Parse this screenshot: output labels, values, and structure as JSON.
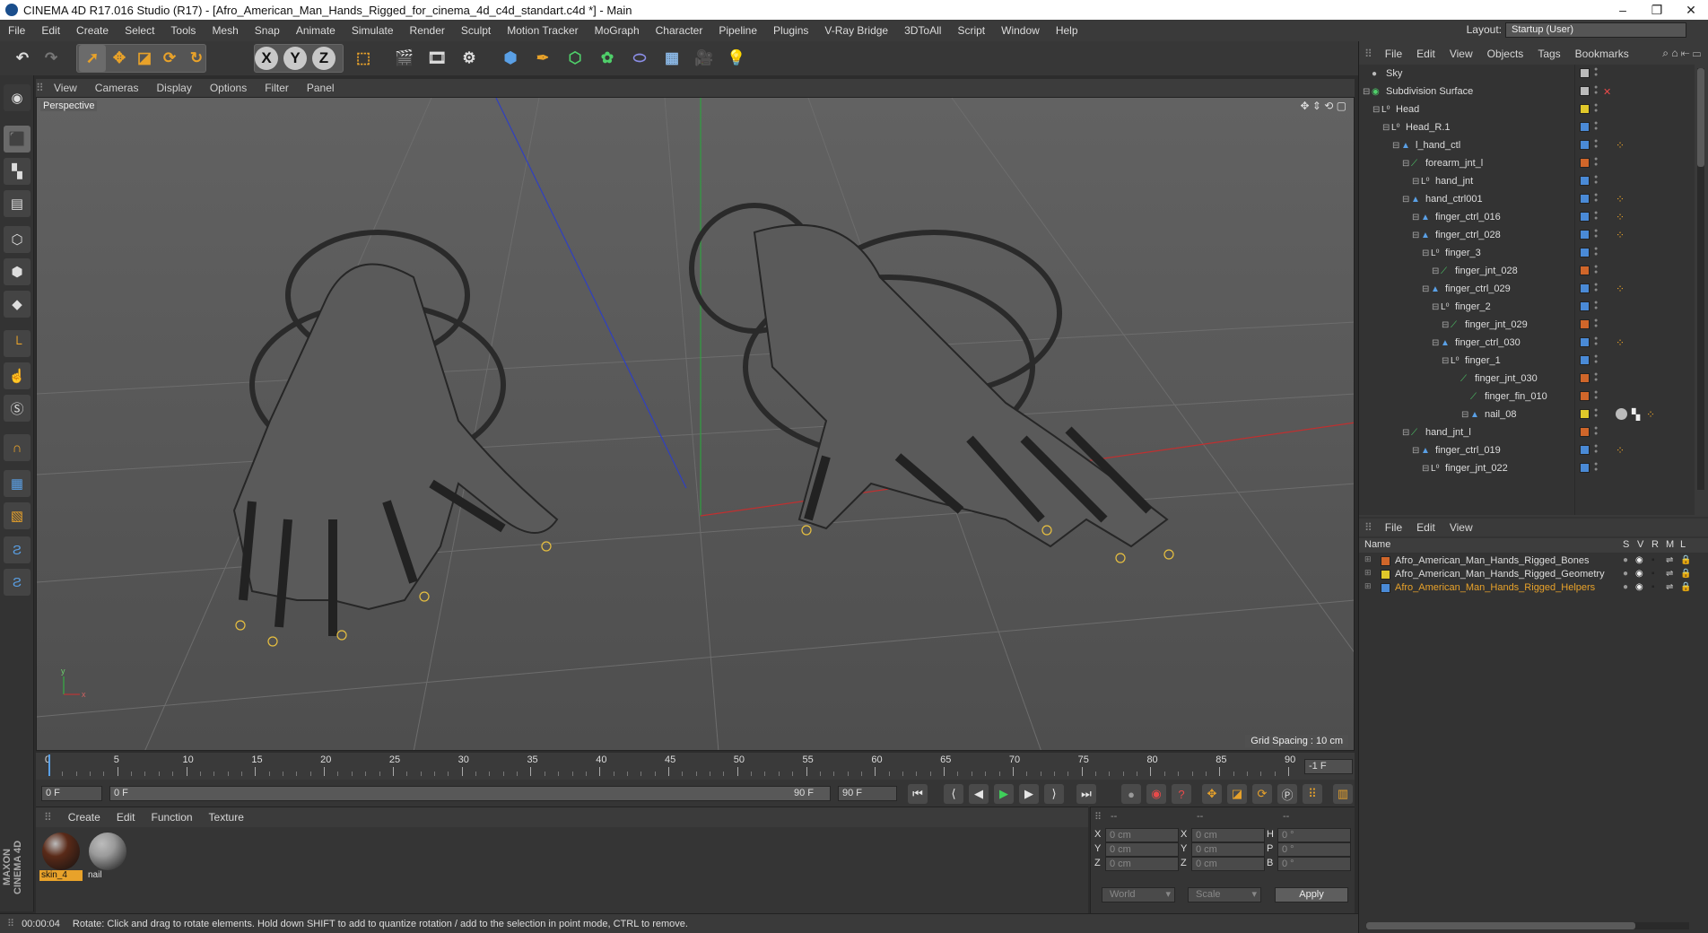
{
  "window": {
    "title": "CINEMA 4D R17.016 Studio (R17) - [Afro_American_Man_Hands_Rigged_for_cinema_4d_c4d_standart.c4d *] - Main",
    "controls": [
      "–",
      "❐",
      "✕"
    ]
  },
  "menubar": {
    "items": [
      "File",
      "Edit",
      "Create",
      "Select",
      "Tools",
      "Mesh",
      "Snap",
      "Animate",
      "Simulate",
      "Render",
      "Sculpt",
      "Motion Tracker",
      "MoGraph",
      "Character",
      "Pipeline",
      "Plugins",
      "V-Ray Bridge",
      "3DToAll",
      "Script",
      "Window",
      "Help"
    ],
    "layout_label": "Layout:",
    "layout_value": "Startup (User)"
  },
  "toolbar": {
    "axis_x": "X",
    "axis_y": "Y",
    "axis_z": "Z"
  },
  "viewport": {
    "menu": [
      "View",
      "Cameras",
      "Display",
      "Options",
      "Filter",
      "Panel"
    ],
    "camera_label": "Perspective",
    "grid_spacing": "Grid Spacing : 10 cm",
    "axis_x": "x",
    "axis_y": "y"
  },
  "timeline": {
    "ticks": [
      "0",
      "5",
      "10",
      "15",
      "20",
      "25",
      "30",
      "35",
      "40",
      "45",
      "50",
      "55",
      "60",
      "65",
      "70",
      "75",
      "80",
      "85",
      "90"
    ],
    "current_frame_field": "-1 F"
  },
  "playback": {
    "start_field": "0 F",
    "range_start": "0 F",
    "range_end": "90 F",
    "end_field": "90 F"
  },
  "materials": {
    "menu": [
      "Create",
      "Edit",
      "Function",
      "Texture"
    ],
    "items": [
      {
        "name": "skin_4",
        "color": "#5a2a18"
      },
      {
        "name": "nail",
        "color": "#9a9a9a"
      }
    ]
  },
  "coordinates": {
    "header": [
      "--",
      "--",
      "--"
    ],
    "rows": [
      {
        "l1": "X",
        "v1": "0 cm",
        "l2": "X",
        "v2": "0 cm",
        "l3": "H",
        "v3": "0 °"
      },
      {
        "l1": "Y",
        "v1": "0 cm",
        "l2": "Y",
        "v2": "0 cm",
        "l3": "P",
        "v3": "0 °"
      },
      {
        "l1": "Z",
        "v1": "0 cm",
        "l2": "Z",
        "v2": "0 cm",
        "l3": "B",
        "v3": "0 °"
      }
    ],
    "coord_system": "World",
    "mode": "Scale",
    "apply": "Apply"
  },
  "status": {
    "time": "00:00:04",
    "message": "Rotate: Click and drag to rotate elements. Hold down SHIFT to add to quantize rotation / add to the selection in point mode, CTRL to remove."
  },
  "object_manager": {
    "menu": [
      "File",
      "Edit",
      "View",
      "Objects",
      "Tags",
      "Bookmarks"
    ],
    "rows": [
      {
        "name": "Sky",
        "depth": 0,
        "type": "sky",
        "color": "#bbbbbb"
      },
      {
        "name": "Subdivision Surface",
        "depth": 0,
        "type": "subd",
        "color": "#bbbbbb"
      },
      {
        "name": "Head",
        "depth": 1,
        "type": "null",
        "color": "#e0c82a"
      },
      {
        "name": "Head_R.1",
        "depth": 2,
        "type": "null",
        "color": "#4a8ad6"
      },
      {
        "name": "l_hand_ctl",
        "depth": 3,
        "type": "ctrl",
        "color": "#4a8ad6"
      },
      {
        "name": "forearm_jnt_l",
        "depth": 4,
        "type": "joint",
        "color": "#d0662a"
      },
      {
        "name": "hand_jnt",
        "depth": 5,
        "type": "null",
        "color": "#4a8ad6"
      },
      {
        "name": "hand_ctrl001",
        "depth": 4,
        "type": "ctrl",
        "color": "#4a8ad6"
      },
      {
        "name": "finger_ctrl_016",
        "depth": 5,
        "type": "ctrl",
        "color": "#4a8ad6"
      },
      {
        "name": "finger_ctrl_028",
        "depth": 5,
        "type": "ctrl",
        "color": "#4a8ad6"
      },
      {
        "name": "finger_3",
        "depth": 6,
        "type": "null",
        "color": "#4a8ad6"
      },
      {
        "name": "finger_jnt_028",
        "depth": 7,
        "type": "joint",
        "color": "#d0662a"
      },
      {
        "name": "finger_ctrl_029",
        "depth": 6,
        "type": "ctrl",
        "color": "#4a8ad6"
      },
      {
        "name": "finger_2",
        "depth": 7,
        "type": "null",
        "color": "#4a8ad6"
      },
      {
        "name": "finger_jnt_029",
        "depth": 8,
        "type": "joint",
        "color": "#d0662a"
      },
      {
        "name": "finger_ctrl_030",
        "depth": 7,
        "type": "ctrl",
        "color": "#4a8ad6"
      },
      {
        "name": "finger_1",
        "depth": 8,
        "type": "null",
        "color": "#4a8ad6"
      },
      {
        "name": "finger_jnt_030",
        "depth": 9,
        "type": "joint",
        "color": "#d0662a"
      },
      {
        "name": "finger_fin_010",
        "depth": 10,
        "type": "joint",
        "color": "#d0662a"
      },
      {
        "name": "nail_08",
        "depth": 10,
        "type": "ctrl",
        "color": "#e0c82a"
      },
      {
        "name": "hand_jnt_l",
        "depth": 4,
        "type": "joint",
        "color": "#d0662a"
      },
      {
        "name": "finger_ctrl_019",
        "depth": 5,
        "type": "ctrl",
        "color": "#4a8ad6"
      },
      {
        "name": "finger_jnt_022",
        "depth": 6,
        "type": "null",
        "color": "#4a8ad6"
      }
    ]
  },
  "layer_manager": {
    "menu": [
      "File",
      "Edit",
      "View"
    ],
    "columns": [
      "Name",
      "S",
      "V",
      "R",
      "M",
      "L"
    ],
    "layers": [
      {
        "name": "Afro_American_Man_Hands_Rigged_Bones",
        "color": "#d0662a"
      },
      {
        "name": "Afro_American_Man_Hands_Rigged_Geometry",
        "color": "#e0c82a"
      },
      {
        "name": "Afro_American_Man_Hands_Rigged_Helpers",
        "color": "#4a8ad6"
      }
    ]
  },
  "brand": "MAXON CINEMA 4D"
}
